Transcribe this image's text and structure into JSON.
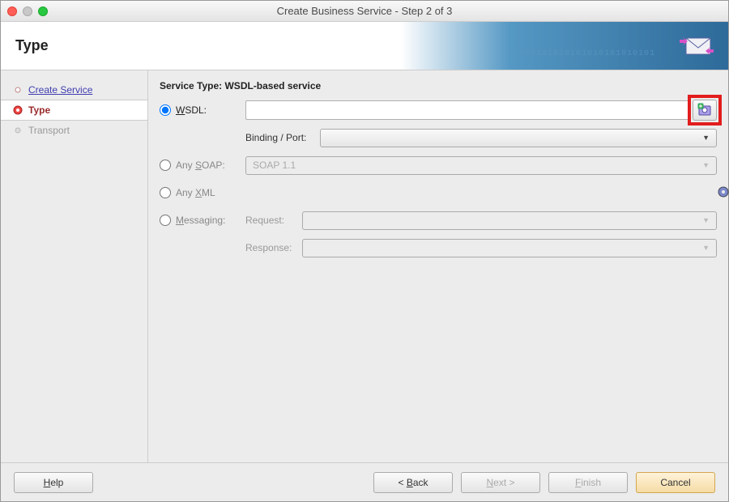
{
  "window": {
    "title": "Create Business Service - Step 2 of 3"
  },
  "banner": {
    "title": "Type",
    "binary": "01010101010101010101010101"
  },
  "sidebar": {
    "items": [
      {
        "label": "Create Service"
      },
      {
        "label": "Type"
      },
      {
        "label": "Transport"
      }
    ]
  },
  "main": {
    "section_title": "Service Type: WSDL-based service",
    "wsdl": {
      "label_pre": "W",
      "label_post": "SDL:",
      "value": "",
      "binding_label": "Binding / Port:",
      "binding_value": ""
    },
    "soap": {
      "label_pre": "Any ",
      "label_u": "S",
      "label_post": "OAP:",
      "value": "SOAP 1.1"
    },
    "xml": {
      "label_pre": "Any ",
      "label_u": "X",
      "label_post": "ML"
    },
    "messaging": {
      "label_pre": "",
      "label_u": "M",
      "label_post": "essaging:",
      "request_label": "Request:",
      "response_label": "Response:",
      "request_value": "",
      "response_value": ""
    }
  },
  "footer": {
    "help": "Help",
    "back": "< Back",
    "next": "Next >",
    "finish": "Finish",
    "cancel": "Cancel"
  }
}
